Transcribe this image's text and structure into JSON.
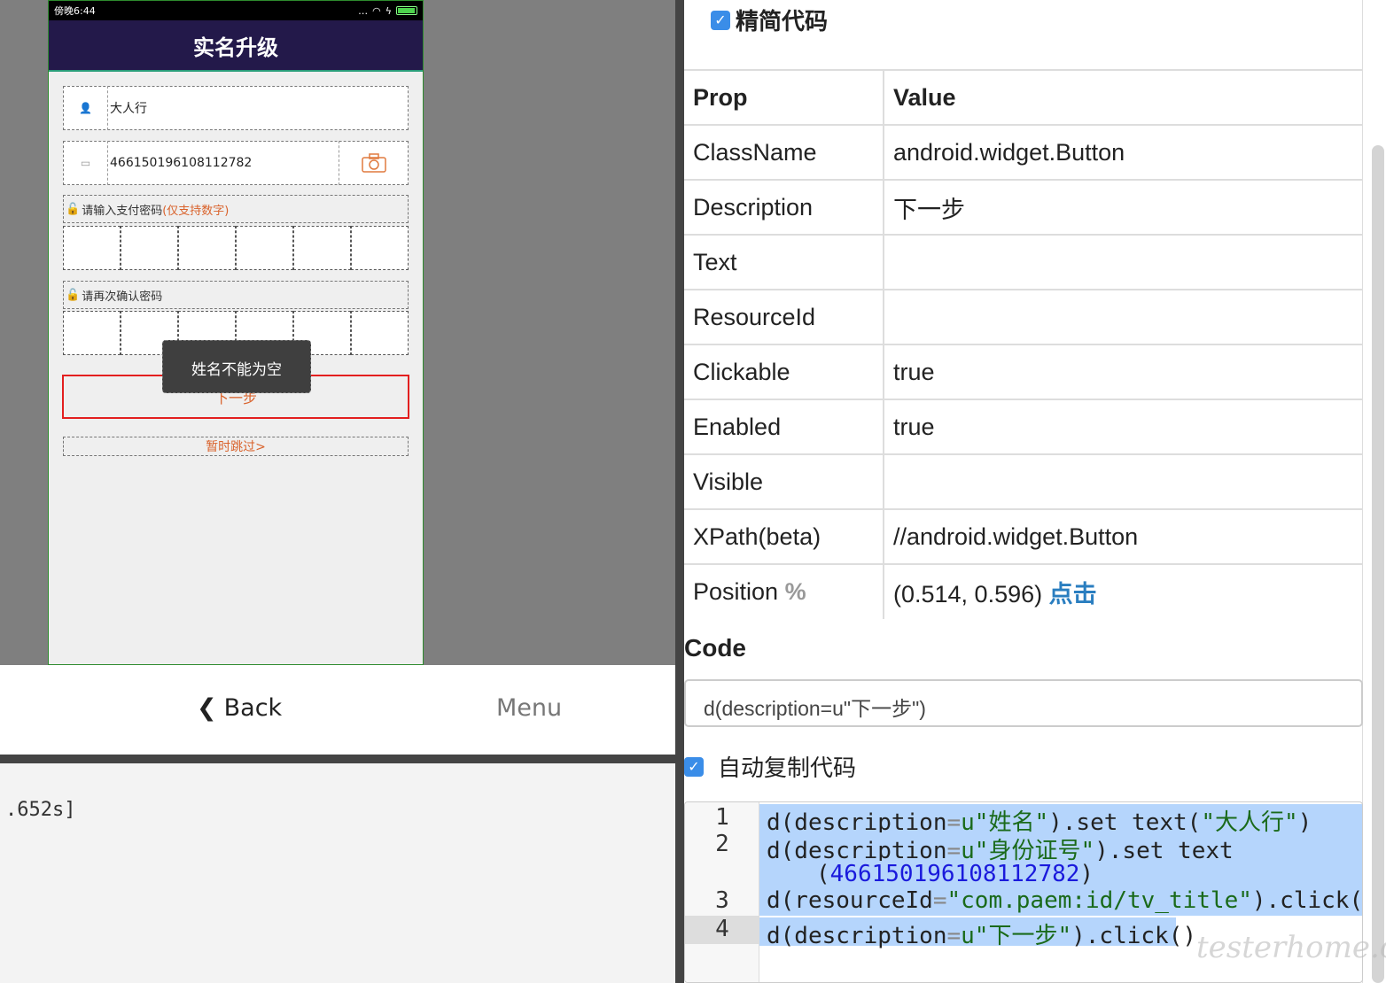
{
  "device": {
    "status_time": "傍晚6:44",
    "app_title": "实名升级",
    "name_value": "大人行",
    "id_value": "466150196108112782",
    "pay_pw_label": "请输入支付密码",
    "pay_pw_hint": "(仅支持数字)",
    "confirm_pw_label": "请再次确认密码",
    "toast": "姓名不能为空",
    "next_label": "下一步",
    "skip_label": "暂时跳过>"
  },
  "nav": {
    "back_label": "Back",
    "menu_label": "Menu"
  },
  "console": {
    "text": ".652s]"
  },
  "inspector": {
    "simplify_label": "精简代码",
    "header_prop": "Prop",
    "header_value": "Value",
    "rows": [
      {
        "prop": "ClassName",
        "value": "android.widget.Button"
      },
      {
        "prop": "Description",
        "value": "下一步"
      },
      {
        "prop": "Text",
        "value": ""
      },
      {
        "prop": "ResourceId",
        "value": ""
      },
      {
        "prop": "Clickable",
        "value": "true"
      },
      {
        "prop": "Enabled",
        "value": "true"
      },
      {
        "prop": "Visible",
        "value": ""
      },
      {
        "prop": "XPath(beta)",
        "value": "//android.widget.Button"
      }
    ],
    "position_prop": "Position",
    "position_unit": "%",
    "position_value": "(0.514, 0.596)",
    "click_link": "点击",
    "code_heading": "Code",
    "code_input": "d(description=u\"下一步\")",
    "auto_copy_label": "自动复制代码"
  },
  "editor": {
    "line_numbers": [
      "1",
      "2",
      "3",
      "4"
    ],
    "l1_a": "d(description",
    "l1_b": "=",
    "l1_c": "u\"姓名\"",
    "l1_d": ").set_text(",
    "l1_e": "\"大人行\"",
    "l1_f": ")",
    "l2_a": "d(description",
    "l2_b": "=",
    "l2_c": "u\"身份证号\"",
    "l2_d": ").set_text",
    "l2w_a": "(",
    "l2w_b": "466150196108112782",
    "l2w_c": ")",
    "l3_a": "d(resourceId",
    "l3_b": "=",
    "l3_c": "\"com.paem:id/tv_title\"",
    "l3_d": ").click()",
    "l4_a": "d(description",
    "l4_b": "=",
    "l4_c": "u\"下一步\"",
    "l4_d": ").click()"
  },
  "watermark": "testerhome.com"
}
